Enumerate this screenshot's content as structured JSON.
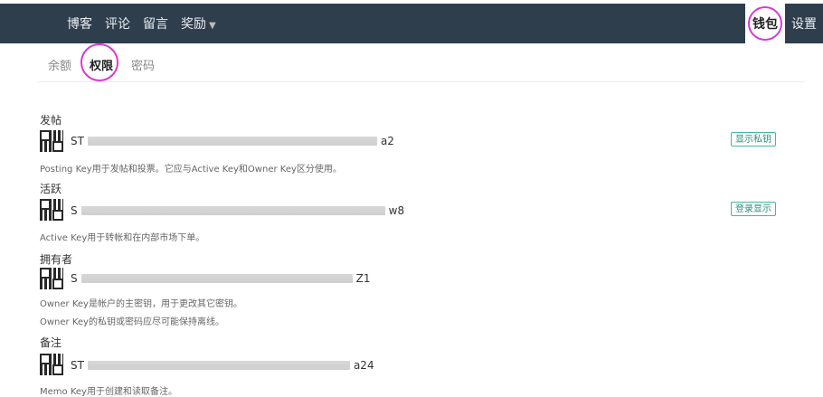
{
  "nav": {
    "items": [
      "博客",
      "评论",
      "留言",
      "奖励"
    ],
    "wallet_label": "钱包",
    "settings_label": "设置"
  },
  "tabs": [
    "余额",
    "权限",
    "密码"
  ],
  "keys": [
    {
      "title": "发帖",
      "prefix": "ST",
      "suffix": "a2",
      "desc": "Posting Key用于发帖和投票。它应与Active Key和Owner Key区分使用。",
      "button": "显示私钥"
    },
    {
      "title": "活跃",
      "prefix": "S",
      "suffix": "w8",
      "desc": "Active Key用于转帐和在内部市场下单。",
      "button": "登录显示"
    },
    {
      "title": "拥有者",
      "prefix": "S",
      "suffix": "Z1",
      "desc": "Owner Key是帐户的主密钥，用于更改其它密钥。",
      "desc2": "Owner Key的私钥或密码应尽可能保持离线。"
    },
    {
      "title": "备注",
      "prefix": "ST",
      "suffix": "a24",
      "desc": "Memo Key用于创建和读取备注。"
    }
  ]
}
